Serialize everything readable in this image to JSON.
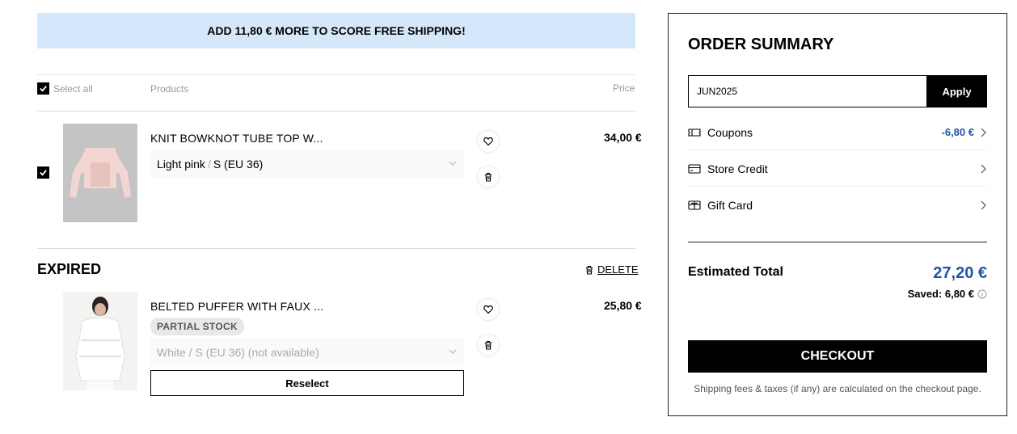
{
  "banner": {
    "text": "ADD 11,80 € MORE TO SCORE FREE SHIPPING!"
  },
  "cart_header": {
    "select_all": "Select all",
    "products": "Products",
    "price": "Price"
  },
  "items": [
    {
      "name": "KNIT BOWKNOT TUBE TOP W...",
      "color": "Light pink",
      "size": "S (EU 36)",
      "price": "34,00 €",
      "checked": true
    }
  ],
  "expired": {
    "title": "EXPIRED",
    "delete_label": "DELETE",
    "items": [
      {
        "name": "BELTED PUFFER WITH FAUX ...",
        "badge": "PARTIAL STOCK",
        "variant": "White / S (EU 36) (not available)",
        "price": "25,80 €",
        "reselect_label": "Reselect"
      }
    ]
  },
  "summary": {
    "title": "ORDER SUMMARY",
    "coupon_code": "JUN2025",
    "apply_label": "Apply",
    "rows": [
      {
        "label": "Coupons",
        "value": "-6,80 €",
        "icon": "ticket-icon"
      },
      {
        "label": "Store Credit",
        "value": "",
        "icon": "card-icon"
      },
      {
        "label": "Gift Card",
        "value": "",
        "icon": "gift-card-icon"
      }
    ],
    "estimated_total_label": "Estimated Total",
    "estimated_total_value": "27,20 €",
    "saved_label": "Saved: 6,80 €",
    "checkout_label": "CHECKOUT",
    "note": "Shipping fees & taxes (if any) are calculated on the checkout page."
  },
  "colors": {
    "banner_bg": "#d5e8fb",
    "accent_blue": "#1d55a8"
  }
}
